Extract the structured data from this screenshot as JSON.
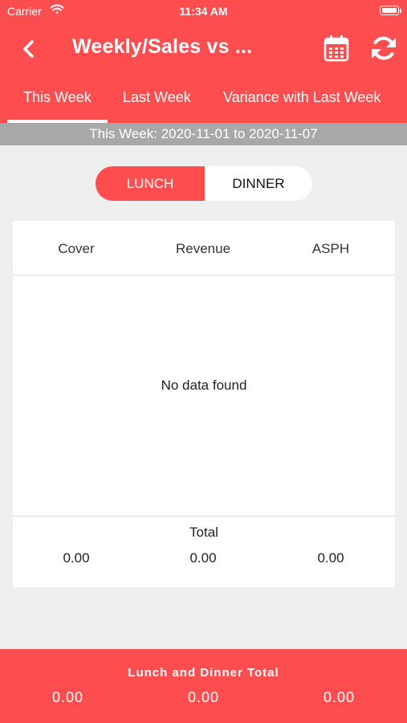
{
  "status_bar": {
    "carrier": "Carrier",
    "time": "11:34 AM"
  },
  "header": {
    "title": "Weekly/Sales vs ...",
    "icons": {
      "back": "chevron-left-icon",
      "calendar": "calendar-icon",
      "refresh": "refresh-icon"
    }
  },
  "tabs": [
    {
      "label": "This Week",
      "selected": true
    },
    {
      "label": "Last Week",
      "selected": false
    },
    {
      "label": "Variance with Last Week",
      "selected": false
    }
  ],
  "date_range": "This Week: 2020-11-01 to 2020-11-07",
  "segment": {
    "options": [
      "LUNCH",
      "DINNER"
    ],
    "selected": "LUNCH"
  },
  "table": {
    "columns": [
      "Cover",
      "Revenue",
      "ASPH"
    ],
    "empty_text": "No data found",
    "total_label": "Total",
    "totals": [
      "0.00",
      "0.00",
      "0.00"
    ]
  },
  "footer": {
    "title": "Lunch and Dinner Total",
    "values": [
      "0.00",
      "0.00",
      "0.00"
    ]
  },
  "colors": {
    "accent": "#fd4d4f",
    "band": "#a8a8a8",
    "background": "#efefef"
  }
}
